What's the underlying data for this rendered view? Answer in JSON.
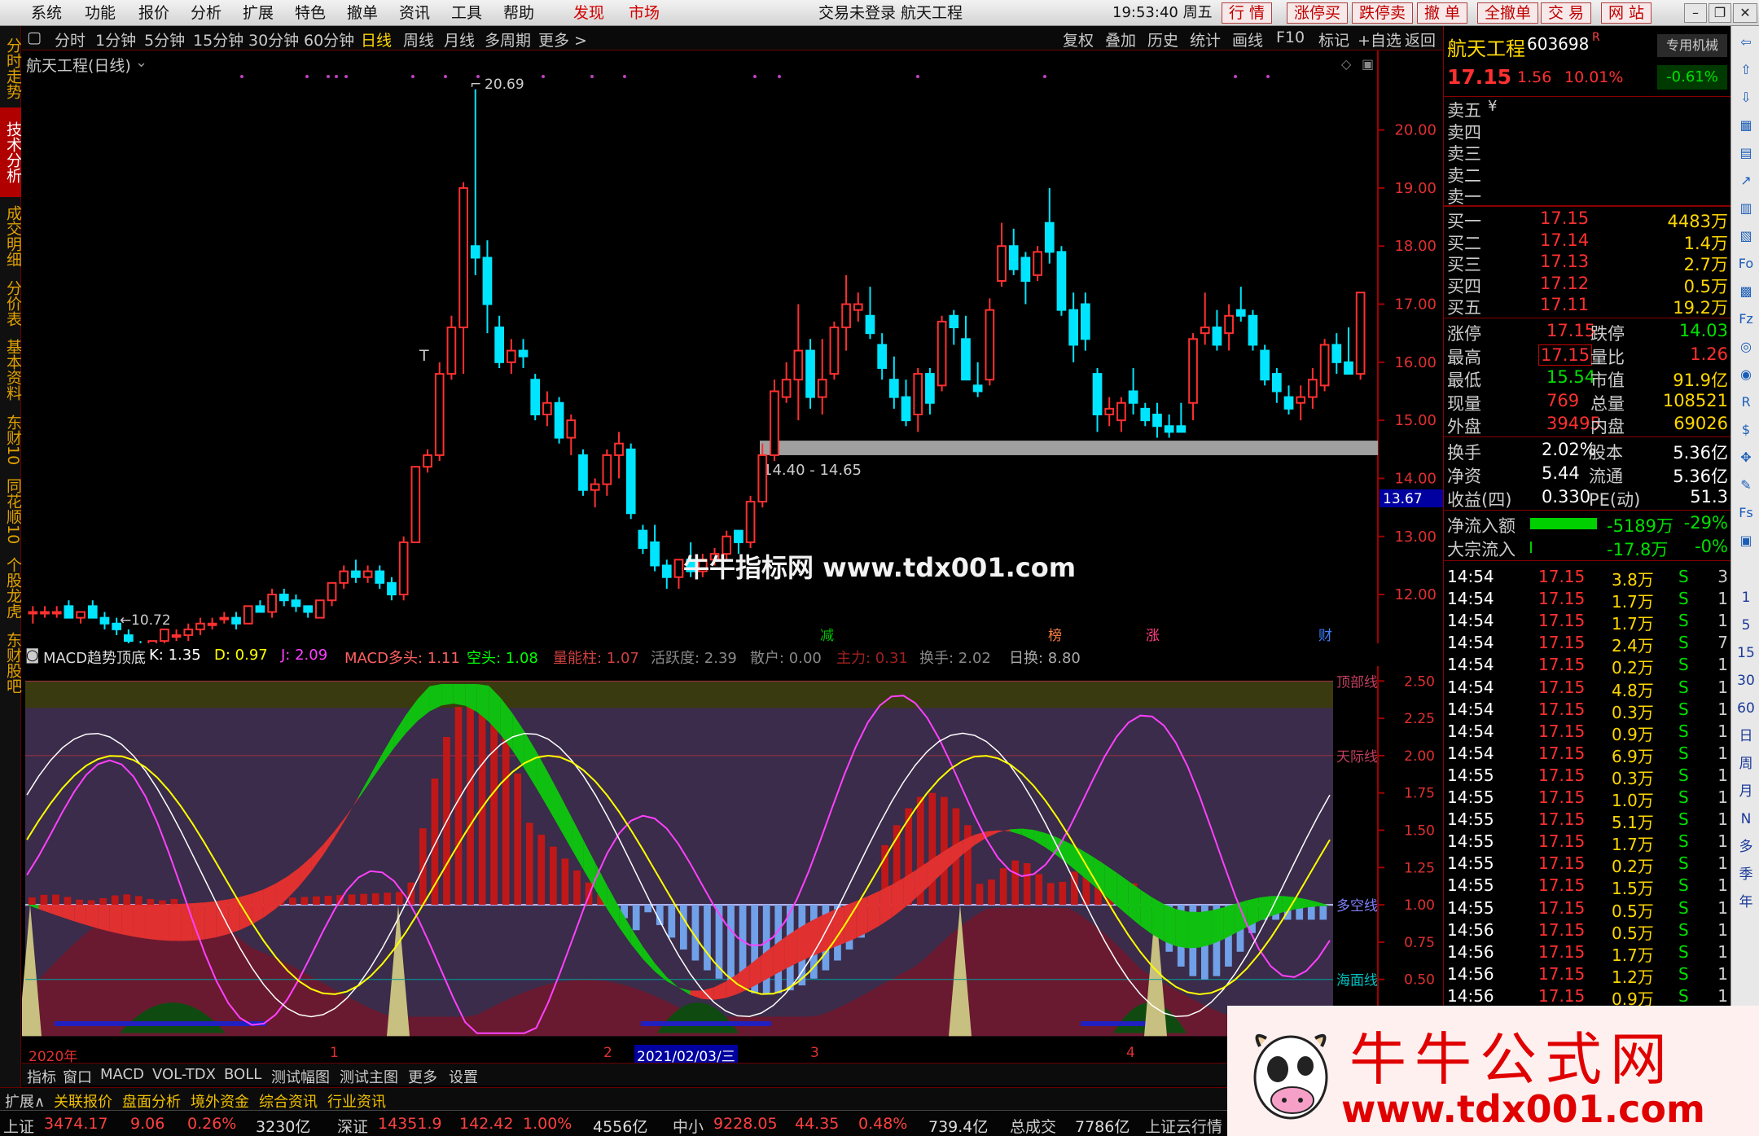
{
  "menu": {
    "items": [
      "系统",
      "功能",
      "报价",
      "分析",
      "扩展",
      "特色",
      "撤单",
      "资讯",
      "工具",
      "帮助",
      "发现",
      "市场"
    ],
    "title": "交易未登录  航天工程",
    "time": "19:53:40 周五",
    "buttons": [
      "行 情",
      "涨停买",
      "跌停卖",
      "撤 单",
      "全撤单",
      "交 易",
      "网 站"
    ]
  },
  "left_tabs": [
    "分时走势",
    "技术分析",
    "成交明细",
    "分价表",
    "基本资料",
    "东财10",
    "同花顺10",
    "个股龙虎",
    "东财股吧"
  ],
  "periods": [
    "分时",
    "1分钟",
    "5分钟",
    "15分钟",
    "30分钟",
    "60分钟",
    "日线",
    "周线",
    "月线",
    "多周期",
    "更多 >"
  ],
  "period_selected": "日线",
  "tools": [
    "复权",
    "叠加",
    "历史",
    "统计",
    "画线",
    "F10",
    "标记",
    "+自选",
    "返回"
  ],
  "chart": {
    "stock_label": "航天工程(日线)",
    "price_labels": [
      "20.00",
      "19.00",
      "18.00",
      "17.00",
      "16.00",
      "15.00",
      "14.00",
      "13.00",
      "12.00"
    ],
    "high_mark": "20.69",
    "low_mark": "10.72",
    "t_mark": "T",
    "zone_label": "14.40 - 14.65",
    "cur_price_tag": "13.67",
    "event_marks": [
      "减",
      "榜",
      "涨",
      "财"
    ],
    "watermark": "牛牛指标网 www.tdx001.com"
  },
  "chart_data": {
    "type": "candlestick",
    "ylim": [
      11.3,
      21.2
    ],
    "ohlc": [
      [
        11.7,
        11.8,
        11.5,
        11.7
      ],
      [
        11.7,
        11.8,
        11.6,
        11.7
      ],
      [
        11.7,
        11.8,
        11.6,
        11.7
      ],
      [
        11.8,
        11.9,
        11.6,
        11.6
      ],
      [
        11.6,
        11.7,
        11.5,
        11.7
      ],
      [
        11.8,
        11.9,
        11.6,
        11.6
      ],
      [
        11.6,
        11.7,
        11.4,
        11.5
      ],
      [
        11.5,
        11.6,
        11.3,
        11.4
      ],
      [
        11.3,
        11.4,
        11.1,
        11.2
      ],
      [
        11.1,
        11.2,
        10.9,
        11.0
      ],
      [
        11.0,
        11.2,
        10.7,
        11.2
      ],
      [
        11.2,
        11.4,
        11.1,
        11.4
      ],
      [
        11.3,
        11.4,
        11.2,
        11.3
      ],
      [
        11.3,
        11.5,
        11.2,
        11.4
      ],
      [
        11.4,
        11.6,
        11.3,
        11.5
      ],
      [
        11.5,
        11.6,
        11.4,
        11.5
      ],
      [
        11.6,
        11.7,
        11.5,
        11.6
      ],
      [
        11.6,
        11.7,
        11.4,
        11.5
      ],
      [
        11.5,
        11.8,
        11.5,
        11.8
      ],
      [
        11.8,
        11.9,
        11.7,
        11.7
      ],
      [
        11.7,
        12.1,
        11.6,
        12.0
      ],
      [
        12.0,
        12.1,
        11.8,
        11.9
      ],
      [
        11.9,
        12.0,
        11.7,
        11.8
      ],
      [
        11.8,
        11.8,
        11.6,
        11.7
      ],
      [
        11.6,
        11.9,
        11.6,
        11.9
      ],
      [
        11.9,
        12.2,
        11.8,
        12.2
      ],
      [
        12.2,
        12.5,
        12.1,
        12.4
      ],
      [
        12.4,
        12.6,
        12.2,
        12.3
      ],
      [
        12.3,
        12.5,
        12.2,
        12.4
      ],
      [
        12.4,
        12.5,
        12.1,
        12.2
      ],
      [
        12.2,
        12.3,
        11.9,
        12.0
      ],
      [
        12.0,
        13.0,
        11.9,
        12.9
      ],
      [
        12.9,
        14.2,
        12.9,
        14.2
      ],
      [
        14.2,
        14.5,
        14.1,
        14.4
      ],
      [
        14.4,
        16.0,
        14.3,
        15.8
      ],
      [
        15.8,
        16.8,
        15.7,
        16.6
      ],
      [
        16.6,
        19.1,
        15.8,
        19.0
      ],
      [
        18.0,
        20.7,
        17.5,
        17.8
      ],
      [
        17.8,
        18.1,
        16.5,
        17.0
      ],
      [
        16.6,
        16.8,
        15.9,
        16.0
      ],
      [
        16.0,
        16.4,
        15.8,
        16.2
      ],
      [
        16.2,
        16.4,
        15.9,
        16.1
      ],
      [
        15.7,
        15.8,
        15.0,
        15.1
      ],
      [
        15.1,
        15.5,
        14.9,
        15.3
      ],
      [
        15.3,
        15.4,
        14.6,
        14.7
      ],
      [
        14.7,
        15.1,
        14.4,
        15.0
      ],
      [
        14.4,
        14.5,
        13.7,
        13.8
      ],
      [
        13.8,
        14.0,
        13.5,
        13.9
      ],
      [
        13.9,
        14.5,
        13.7,
        14.4
      ],
      [
        14.4,
        14.8,
        14.0,
        14.6
      ],
      [
        14.5,
        14.6,
        13.3,
        13.4
      ],
      [
        13.1,
        13.2,
        12.7,
        12.8
      ],
      [
        12.9,
        13.2,
        12.4,
        12.5
      ],
      [
        12.5,
        12.6,
        12.1,
        12.3
      ],
      [
        12.3,
        12.6,
        12.1,
        12.6
      ],
      [
        12.6,
        12.9,
        12.3,
        12.4
      ],
      [
        12.4,
        12.7,
        12.3,
        12.6
      ],
      [
        12.6,
        12.8,
        12.5,
        12.7
      ],
      [
        12.7,
        13.1,
        12.6,
        13.0
      ],
      [
        13.1,
        13.1,
        12.7,
        12.9
      ],
      [
        12.9,
        13.7,
        12.8,
        13.6
      ],
      [
        13.6,
        14.6,
        13.5,
        14.4
      ],
      [
        14.4,
        15.7,
        14.3,
        15.5
      ],
      [
        15.4,
        16.0,
        15.3,
        15.7
      ],
      [
        15.7,
        17.0,
        15.0,
        16.2
      ],
      [
        16.2,
        16.4,
        15.2,
        15.4
      ],
      [
        15.4,
        16.4,
        15.1,
        15.7
      ],
      [
        15.8,
        16.7,
        15.7,
        16.6
      ],
      [
        16.6,
        17.5,
        16.2,
        17.0
      ],
      [
        16.9,
        17.2,
        16.7,
        17.0
      ],
      [
        16.8,
        17.3,
        16.4,
        16.5
      ],
      [
        16.3,
        16.5,
        15.7,
        15.9
      ],
      [
        15.7,
        16.1,
        15.2,
        15.4
      ],
      [
        15.4,
        15.7,
        14.9,
        15.0
      ],
      [
        15.1,
        15.9,
        14.8,
        15.8
      ],
      [
        15.8,
        15.9,
        15.1,
        15.3
      ],
      [
        15.6,
        16.8,
        15.5,
        16.7
      ],
      [
        16.8,
        16.9,
        16.3,
        16.6
      ],
      [
        16.4,
        16.8,
        15.7,
        15.7
      ],
      [
        15.6,
        16.0,
        15.4,
        15.5
      ],
      [
        15.7,
        17.1,
        15.6,
        16.9
      ],
      [
        17.4,
        18.4,
        17.3,
        18.0
      ],
      [
        18.0,
        18.3,
        17.5,
        17.6
      ],
      [
        17.8,
        17.9,
        17.0,
        17.4
      ],
      [
        17.5,
        18.0,
        17.4,
        17.9
      ],
      [
        18.4,
        19.0,
        17.7,
        17.9
      ],
      [
        17.9,
        18.0,
        16.8,
        16.9
      ],
      [
        16.9,
        17.2,
        16.0,
        16.3
      ],
      [
        17.0,
        17.2,
        16.2,
        16.4
      ],
      [
        15.8,
        15.9,
        14.8,
        15.1
      ],
      [
        15.1,
        15.4,
        14.9,
        15.2
      ],
      [
        15.0,
        15.4,
        14.8,
        15.3
      ],
      [
        15.5,
        15.9,
        15.1,
        15.3
      ],
      [
        15.2,
        15.3,
        14.9,
        15.0
      ],
      [
        15.1,
        15.3,
        14.7,
        14.9
      ],
      [
        14.9,
        15.1,
        14.7,
        14.8
      ],
      [
        14.9,
        15.3,
        14.8,
        14.8
      ],
      [
        15.3,
        16.5,
        15.0,
        16.4
      ],
      [
        16.5,
        17.2,
        16.3,
        16.6
      ],
      [
        16.6,
        16.9,
        16.2,
        16.3
      ],
      [
        16.5,
        17.0,
        16.2,
        16.8
      ],
      [
        16.9,
        17.3,
        16.7,
        16.8
      ],
      [
        16.8,
        16.9,
        16.2,
        16.3
      ],
      [
        16.2,
        16.3,
        15.6,
        15.7
      ],
      [
        15.8,
        15.9,
        15.3,
        15.5
      ],
      [
        15.4,
        15.6,
        15.1,
        15.2
      ],
      [
        15.3,
        15.6,
        15.0,
        15.4
      ],
      [
        15.4,
        15.9,
        15.2,
        15.7
      ],
      [
        15.6,
        16.4,
        15.5,
        16.3
      ],
      [
        16.3,
        16.5,
        15.8,
        16.0
      ],
      [
        16.0,
        16.6,
        15.8,
        15.8
      ],
      [
        15.8,
        17.2,
        15.7,
        17.2
      ]
    ],
    "indicator": {
      "name": "MACD趋势顶底",
      "ylim": [
        0.1,
        2.6
      ],
      "levels": [
        {
          "name": "顶部线",
          "value": 2.5
        },
        {
          "name": "天际线",
          "value": 2.0
        },
        {
          "name": "多空线",
          "value": 1.0
        },
        {
          "name": "海面线",
          "value": 0.5
        }
      ],
      "ticks": [
        "2.50",
        "2.25",
        "2.00",
        "1.75",
        "1.50",
        "1.25",
        "1.00",
        "0.75",
        "0.50"
      ]
    }
  },
  "indicator_header": {
    "name": "MACD趋势顶底",
    "K": "K: 1.35",
    "D": "D: 0.97",
    "J": "J: 2.09",
    "macd_long": "MACD多头: 1.11",
    "short": "空头: 1.08",
    "vol": "量能柱: 1.07",
    "act": "活跃度: 2.39",
    "retail": "散户: 0.00",
    "main": "主力: 0.31",
    "turn": "换手: 2.02",
    "dturn": "日换: 8.80"
  },
  "dates": {
    "y": "2020年",
    "m1": "1",
    "m2": "2",
    "sel": "2021/02/03/三",
    "m3": "3",
    "m4": "4"
  },
  "bottom_tabs": [
    "指标",
    "窗口",
    "MACD",
    "VOL-TDX",
    "BOLL",
    "测试幅图",
    "测试主图",
    "更多",
    "设置"
  ],
  "bottom_tabs2": [
    "扩展∧",
    "关联报价",
    "盘面分析",
    "境外资金",
    "综合资讯",
    "行业资讯"
  ],
  "status": {
    "sh_label": "上证",
    "sh": "3474.17",
    "sh_chg": "9.06",
    "sh_pct": "0.26%",
    "sh_amt": "3230亿",
    "sz_label": "深证",
    "sz": "14351.9",
    "sz_chg": "142.42",
    "sz_pct": "1.00%",
    "sz_amt": "4556亿",
    "zx_label": "中小",
    "zx": "9228.05",
    "zx_chg": "44.35",
    "zx_pct": "0.48%",
    "zx_amt": "739.4亿",
    "total_label": "总成交",
    "total": "7786亿",
    "tail": "上证云行情"
  },
  "quote": {
    "name": "航天工程",
    "code": "603698",
    "r": "R",
    "badge": "专用机械",
    "price": "17.15",
    "chg": "1.56",
    "pct": "10.01%",
    "pct2": "-0.61%",
    "sells": [
      "卖五",
      "卖四",
      "卖三",
      "卖二",
      "卖一"
    ],
    "sell_mark": "¥",
    "buys": [
      {
        "l": "买一",
        "p": "17.15",
        "v": "4483万"
      },
      {
        "l": "买二",
        "p": "17.14",
        "v": "1.4万"
      },
      {
        "l": "买三",
        "p": "17.13",
        "v": "2.7万"
      },
      {
        "l": "买四",
        "p": "17.12",
        "v": "0.5万"
      },
      {
        "l": "买五",
        "p": "17.11",
        "v": "19.2万"
      }
    ],
    "stats": [
      {
        "a": "涨停",
        "b": "17.15",
        "c": "跌停",
        "d": "14.03"
      },
      {
        "a": "最高",
        "b": "17.15",
        "c": "量比",
        "d": "1.26"
      },
      {
        "a": "最低",
        "b": "15.54",
        "c": "市值",
        "d": "91.9亿"
      },
      {
        "a": "现量",
        "b": "769",
        "c": "总量",
        "d": "108521"
      },
      {
        "a": "外盘",
        "b": "39495",
        "c": "内盘",
        "d": "69026"
      }
    ],
    "stats2": [
      {
        "a": "换手",
        "b": "2.02%",
        "c": "股本",
        "d": "5.36亿"
      },
      {
        "a": "净资",
        "b": "5.44",
        "c": "流通",
        "d": "5.36亿"
      },
      {
        "a": "收益(四)",
        "b": "0.330",
        "c": "PE(动)",
        "d": "51.3"
      }
    ],
    "flow": [
      {
        "a": "净流入额",
        "b": "-5189万",
        "c": "-29%"
      },
      {
        "a": "大宗流入",
        "b": "-17.8万",
        "c": "-0%"
      }
    ],
    "ticks": [
      {
        "t": "14:54",
        "p": "17.15",
        "v": "3.8万",
        "s": "S",
        "n": "3"
      },
      {
        "t": "14:54",
        "p": "17.15",
        "v": "1.7万",
        "s": "S",
        "n": "1"
      },
      {
        "t": "14:54",
        "p": "17.15",
        "v": "1.7万",
        "s": "S",
        "n": "1"
      },
      {
        "t": "14:54",
        "p": "17.15",
        "v": "2.4万",
        "s": "S",
        "n": "7"
      },
      {
        "t": "14:54",
        "p": "17.15",
        "v": "0.2万",
        "s": "S",
        "n": "1"
      },
      {
        "t": "14:54",
        "p": "17.15",
        "v": "4.8万",
        "s": "S",
        "n": "1"
      },
      {
        "t": "14:54",
        "p": "17.15",
        "v": "0.3万",
        "s": "S",
        "n": "1"
      },
      {
        "t": "14:54",
        "p": "17.15",
        "v": "0.9万",
        "s": "S",
        "n": "1"
      },
      {
        "t": "14:54",
        "p": "17.15",
        "v": "6.9万",
        "s": "S",
        "n": "1"
      },
      {
        "t": "14:55",
        "p": "17.15",
        "v": "0.3万",
        "s": "S",
        "n": "1"
      },
      {
        "t": "14:55",
        "p": "17.15",
        "v": "1.0万",
        "s": "S",
        "n": "1"
      },
      {
        "t": "14:55",
        "p": "17.15",
        "v": "5.1万",
        "s": "S",
        "n": "1"
      },
      {
        "t": "14:55",
        "p": "17.15",
        "v": "1.7万",
        "s": "S",
        "n": "1"
      },
      {
        "t": "14:55",
        "p": "17.15",
        "v": "0.2万",
        "s": "S",
        "n": "1"
      },
      {
        "t": "14:55",
        "p": "17.15",
        "v": "1.5万",
        "s": "S",
        "n": "1"
      },
      {
        "t": "14:55",
        "p": "17.15",
        "v": "0.5万",
        "s": "S",
        "n": "1"
      },
      {
        "t": "14:56",
        "p": "17.15",
        "v": "0.5万",
        "s": "S",
        "n": "1"
      },
      {
        "t": "14:56",
        "p": "17.15",
        "v": "1.7万",
        "s": "S",
        "n": "1"
      },
      {
        "t": "14:56",
        "p": "17.15",
        "v": "1.2万",
        "s": "S",
        "n": "1"
      },
      {
        "t": "14:56",
        "p": "17.15",
        "v": "0.9万",
        "s": "S",
        "n": "1"
      }
    ]
  },
  "right_toolbar": [
    "1",
    "5",
    "15",
    "30",
    "60",
    "日",
    "周",
    "月",
    "N",
    "多",
    "季",
    "年"
  ],
  "ad": {
    "title": "牛牛公式网",
    "url": "www.tdx001.com"
  }
}
